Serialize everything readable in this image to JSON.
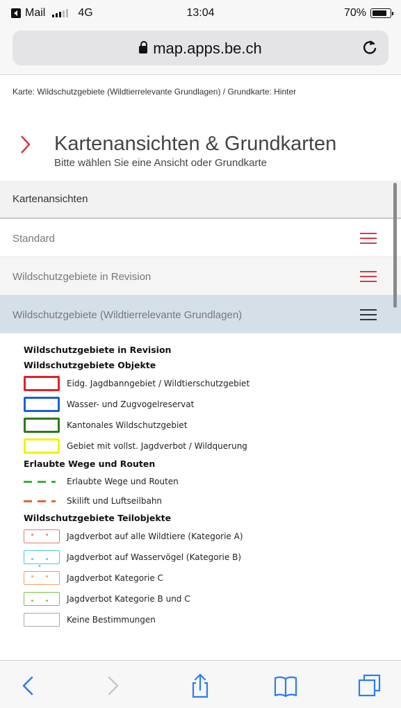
{
  "status_bar": {
    "carrier": "Mail",
    "network": "4G",
    "time": "13:04",
    "battery": "70%",
    "battery_level": 0.7
  },
  "browser": {
    "url": "map.apps.be.ch"
  },
  "breadcrumb": "Karte: Wildschutzgebiete (Wildtierrelevante Grundlagen) / Grundkarte: Hinter",
  "header": {
    "title": "Kartenansichten & Grundkarten",
    "subtitle": "Bitte wählen Sie eine Ansicht oder Grundkarte"
  },
  "panel": {
    "header": "Kartenansichten",
    "items": [
      {
        "label": "Standard"
      },
      {
        "label": "Wildschutzgebiete in Revision"
      },
      {
        "label": "Wildschutzgebiete (Wildtierrelevante Grundlagen)"
      }
    ]
  },
  "legend": {
    "title": "Wildschutzgebiete in Revision",
    "section1": "Wildschutzgebiete Objekte",
    "objects": [
      {
        "label": "Eidg. Jagdbanngebiet / Wildtierschutzgebiet",
        "color": "#e0202a"
      },
      {
        "label": "Wasser- und Zugvogelreservat",
        "color": "#1c5fd6"
      },
      {
        "label": "Kantonales Wildschutzgebiet",
        "color": "#2a7a1a"
      },
      {
        "label": "Gebiet mit vollst. Jagdverbot / Wildquerung",
        "color": "#f2f20a"
      }
    ],
    "section2": "Erlaubte Wege und Routen",
    "routes": [
      {
        "label": "Erlaubte Wege und Routen",
        "color": "#32b832"
      },
      {
        "label": "Skilift und Luftseilbahn",
        "color": "#e8662a"
      }
    ],
    "section3": "Wildschutzgebiete Teilobjekte",
    "parts": [
      {
        "label": "Jagdverbot auf alle Wildtiere (Kategorie A)",
        "color": "#e07a6a"
      },
      {
        "label": "Jagdverbot auf Wasservögel (Kategorie B)",
        "color": "#4ec3e0"
      },
      {
        "label": "Jagdverbot Kategorie C",
        "color": "#f0a060"
      },
      {
        "label": "Jagdverbot Kategorie B und C",
        "color": "#7ac04a"
      },
      {
        "label": "Keine Bestimmungen",
        "color": "#aaaaaa"
      }
    ]
  },
  "colors": {
    "accent_red": "#d23c49",
    "selected_row": "#d5dfe8"
  }
}
